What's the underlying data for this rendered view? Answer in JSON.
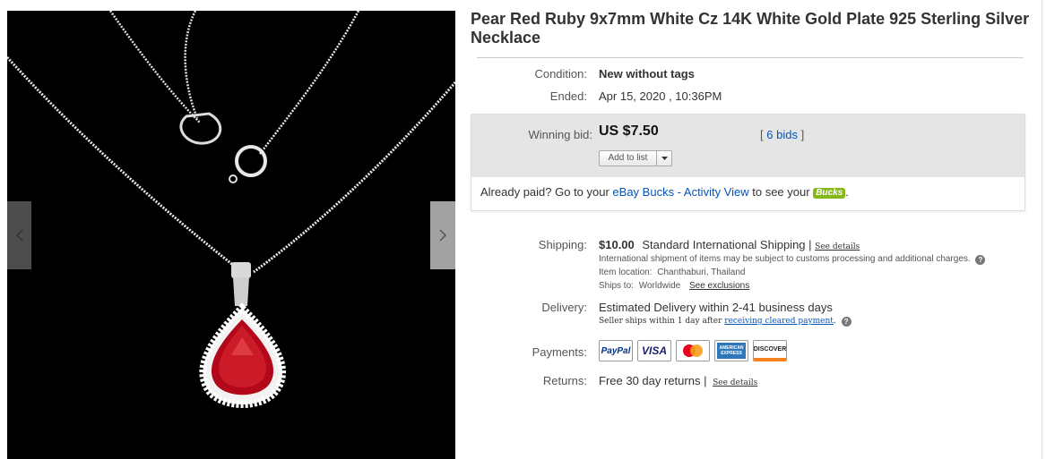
{
  "listing": {
    "title": "Pear Red Ruby 9x7mm White Cz 14K White Gold Plate 925 Sterling Silver Necklace"
  },
  "details": {
    "condition_label": "Condition:",
    "condition_value": "New without tags",
    "ended_label": "Ended:",
    "ended_value": "Apr 15, 2020 , 10:36PM"
  },
  "bid": {
    "label": "Winning bid:",
    "price": "US $7.50",
    "bids_open": "[",
    "bids_link": "6 bids",
    "bids_close": "]",
    "add_to_list": "Add to list",
    "paid_prefix": "Already paid? Go to your ",
    "paid_link": "eBay Bucks - Activity View",
    "paid_suffix": " to see your ",
    "bucks_badge": "Bucks",
    "paid_end": "."
  },
  "shipping": {
    "label": "Shipping:",
    "price": "$10.00",
    "method": "Standard International Shipping",
    "sep": "|",
    "see_details": "See details",
    "customs_note": "International shipment of items may be subject to customs processing and additional charges.",
    "location_label": "Item location:",
    "location_value": "Chanthaburi, Thailand",
    "ships_to_label": "Ships to:",
    "ships_to_value": "Worldwide",
    "see_exclusions": "See exclusions"
  },
  "delivery": {
    "label": "Delivery:",
    "estimate": "Estimated Delivery within 2-41 business days",
    "seller_note": "Seller ships within 1 day after ",
    "seller_link": "receiving cleared payment",
    "seller_end": "."
  },
  "payments": {
    "label": "Payments:",
    "methods": [
      "PayPal",
      "VISA",
      "MasterCard",
      "AMERICAN EXPRESS",
      "DISCOVER"
    ]
  },
  "returns": {
    "label": "Returns:",
    "value": "Free 30 day returns",
    "sep": "|",
    "see_details": "See details"
  },
  "icons": {
    "prev": "chevron-left-icon",
    "next": "chevron-right-icon",
    "dropdown": "caret-down-icon",
    "help": "help-icon"
  },
  "colors": {
    "link": "#0654ba",
    "bid_bg": "#e5e5e5",
    "bucks": "#86b817"
  }
}
